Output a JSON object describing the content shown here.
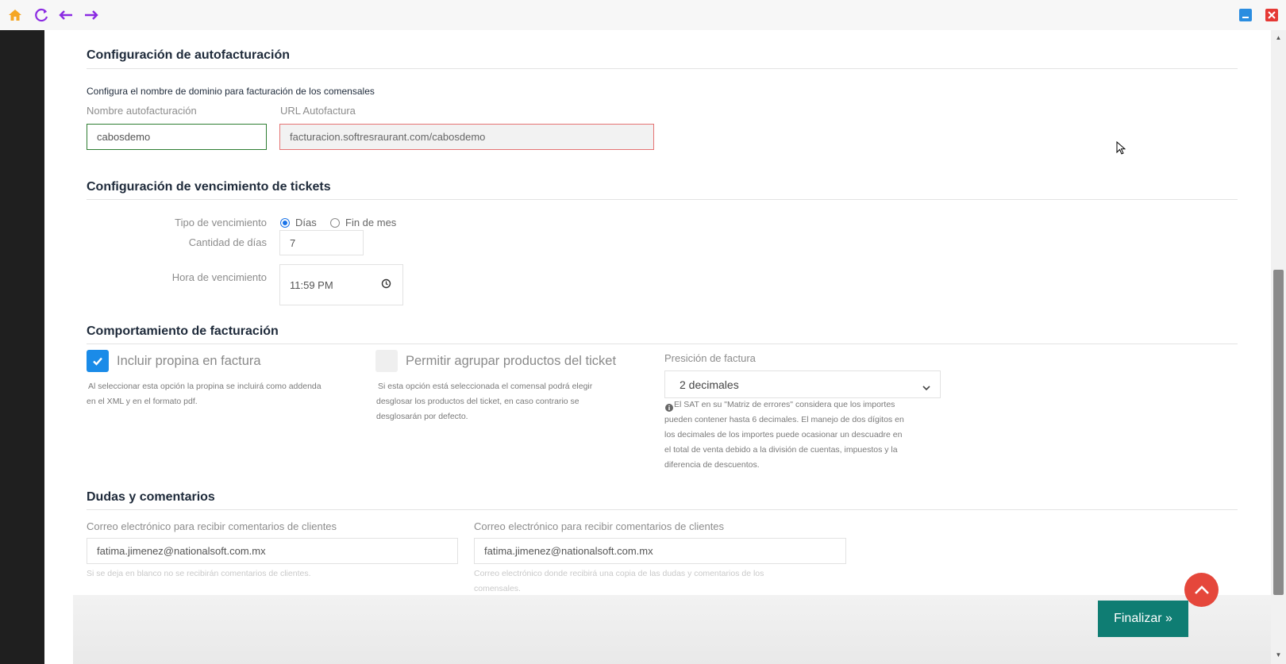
{
  "window": {
    "colors": {
      "home": "#f5a623",
      "nav": "#8b2be2",
      "minimize": "#2a8de0",
      "close": "#e53935"
    }
  },
  "autofacturacion": {
    "title": "Configuración de autofacturación",
    "subtitle": "Configura el nombre de dominio para facturación de los comensales",
    "name_label": "Nombre autofacturación",
    "name_value": "cabosdemo",
    "url_label": "URL Autofactura",
    "url_value": "facturacion.softresraurant.com/cabosdemo"
  },
  "vencimiento": {
    "title": "Configuración de vencimiento de tickets",
    "tipo_label": "Tipo de vencimiento",
    "option_dias": "Días",
    "option_fin_mes": "Fin de mes",
    "selected": "Días",
    "cantidad_label": "Cantidad de días",
    "cantidad_value": "7",
    "hora_label": "Hora de vencimiento",
    "hora_value": "11:59 PM"
  },
  "comportamiento": {
    "title": "Comportamiento de facturación",
    "propina_label": "Incluir propina en factura",
    "propina_checked": true,
    "propina_help_1": "Al seleccionar esta opción la propina se incluirá como addenda",
    "propina_help_2": "en el XML y en el formato pdf.",
    "agrupar_label": "Permitir agrupar productos del ticket",
    "agrupar_checked": false,
    "agrupar_help_1": "Si esta opción está seleccionada el comensal podrá elegir",
    "agrupar_help_2": "desglosar los productos del ticket, en caso contrario se",
    "agrupar_help_3": "desglosarán por defecto.",
    "precision_label": "Presición de factura",
    "precision_value": "2 decimales",
    "precision_help_1": "El SAT en su \"Matriz de errores\" considera que los importes",
    "precision_help_2": "pueden contener hasta 6 decimales. El manejo de dos dígitos en",
    "precision_help_3": "los decimales de los importes puede ocasionar un descuadre en",
    "precision_help_4": "el total de venta debido a la división de cuentas, impuestos y la",
    "precision_help_5": "diferencia de descuentos."
  },
  "dudas": {
    "title": "Dudas y comentarios",
    "email1_label": "Correo electrónico para recibir comentarios de clientes",
    "email1_value": "fatima.jimenez@nationalsoft.com.mx",
    "email1_help": "Si se deja en blanco no se recibirán comentarios de clientes.",
    "email2_label": "Correo electrónico para recibir comentarios de clientes",
    "email2_value": "fatima.jimenez@nationalsoft.com.mx",
    "email2_help_1": "Correo electrónico donde recibirá una copia de las dudas y comentarios de los",
    "email2_help_2": "comensales."
  },
  "footer": {
    "finalizar_label": "Finalizar »"
  }
}
